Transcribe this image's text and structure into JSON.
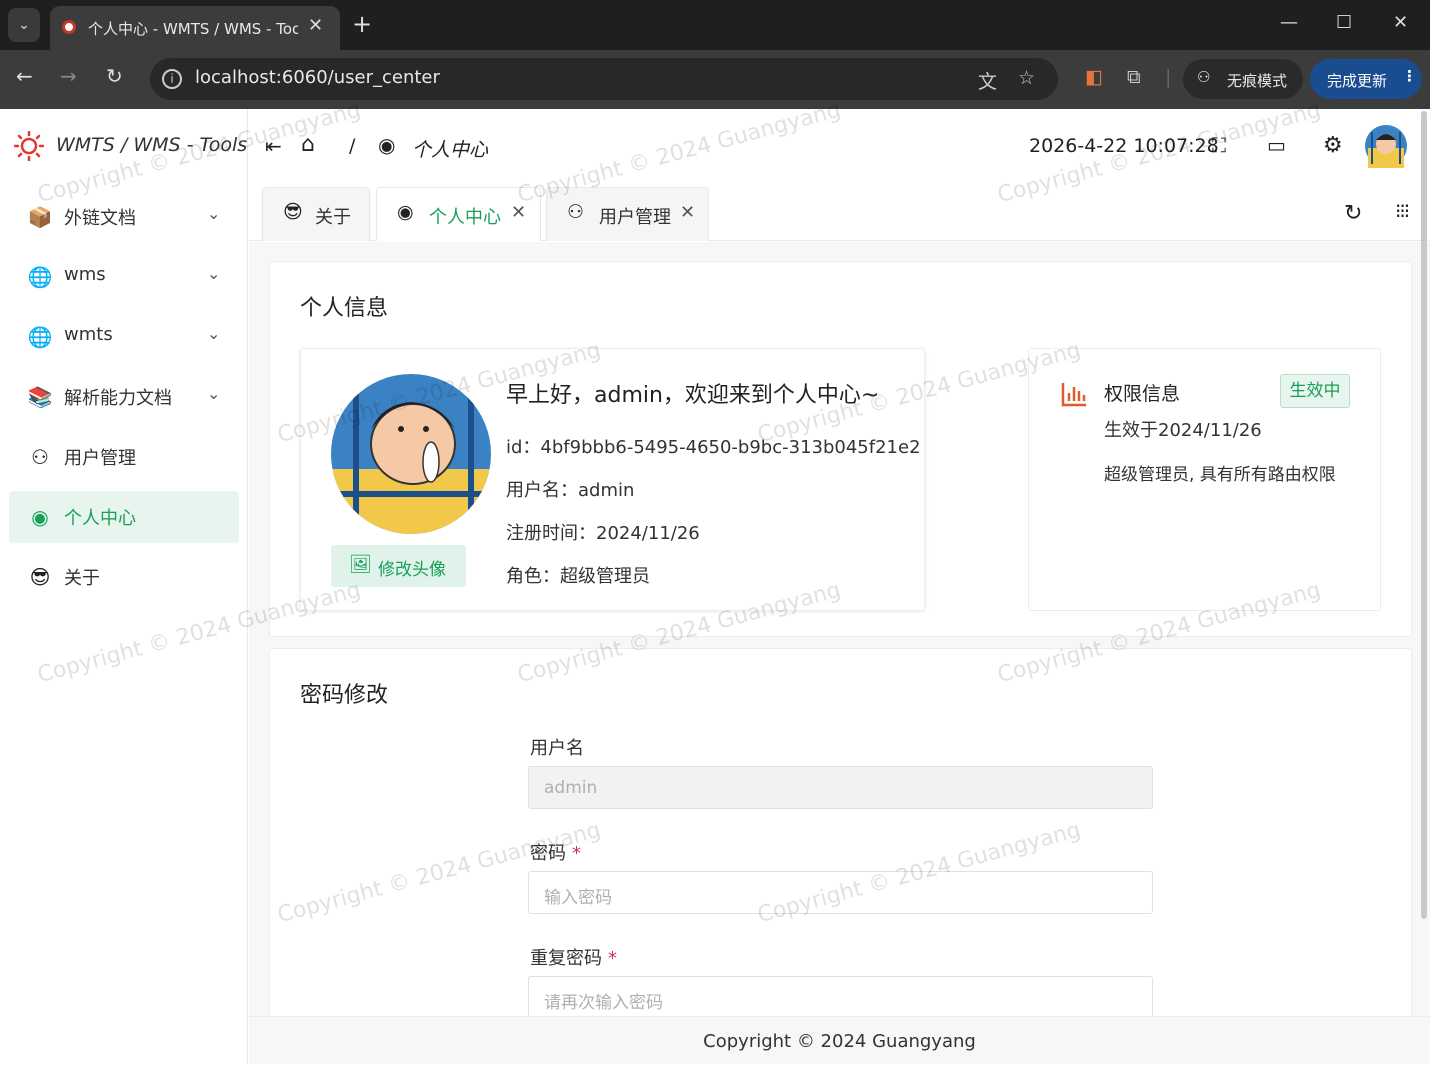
{
  "browser": {
    "tab_title": "个人中心 - WMTS / WMS - Tools",
    "url": "localhost:6060/user_center",
    "incognito_label": "无痕模式",
    "update_label": "完成更新"
  },
  "app": {
    "logo_text": "WMTS / WMS - Tools",
    "breadcrumb_separator": "/",
    "breadcrumb_current": "个人中心",
    "datetime": "2026-4-22 10:07:28",
    "footer": "Copyright © 2024 Guangyang",
    "watermark": "Copyright © 2024 Guangyang"
  },
  "sidebar": {
    "items": [
      {
        "label": "外链文档",
        "icon": "folder-docs-icon",
        "expandable": true
      },
      {
        "label": "wms",
        "icon": "globe-wms-icon",
        "expandable": true
      },
      {
        "label": "wmts",
        "icon": "globe-wmts-icon",
        "expandable": true
      },
      {
        "label": "解析能力文档",
        "icon": "books-icon",
        "expandable": true
      },
      {
        "label": "用户管理",
        "icon": "users-icon",
        "expandable": false
      },
      {
        "label": "个人中心",
        "icon": "user-circle-icon",
        "expandable": false,
        "active": true
      },
      {
        "label": "关于",
        "icon": "sunglasses-icon",
        "expandable": false
      }
    ]
  },
  "tabs": [
    {
      "label": "关于",
      "closable": false
    },
    {
      "label": "个人中心",
      "closable": true,
      "active": true
    },
    {
      "label": "用户管理",
      "closable": true
    }
  ],
  "profile": {
    "section_title": "个人信息",
    "greeting": "早上好，admin，欢迎来到个人中心~",
    "id_line": "id：4bf9bbb6-5495-4650-b9bc-313b045f21e2",
    "username_line": "用户名：admin",
    "registered_line": "注册时间：2024/11/26",
    "role_line": "角色：超级管理员",
    "change_avatar_label": "修改头像"
  },
  "permission": {
    "title": "权限信息",
    "status_badge": "生效中",
    "effective_line": "生效于2024/11/26",
    "description": "超级管理员, 具有所有路由权限"
  },
  "password_form": {
    "section_title": "密码修改",
    "username_label": "用户名",
    "username_value": "admin",
    "password_label": "密码",
    "password_placeholder": "输入密码",
    "repeat_label": "重复密码",
    "repeat_placeholder": "请再次输入密码",
    "required_mark": "*"
  },
  "colors": {
    "accent": "#18a058",
    "active_bg": "#e7f5ee",
    "required": "#d03050",
    "update_button": "#1a4d8f"
  }
}
